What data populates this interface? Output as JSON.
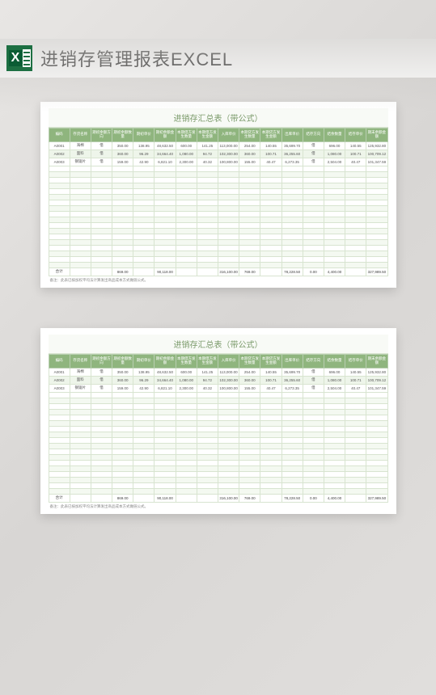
{
  "header": {
    "title": "进销存管理报表EXCEL",
    "icon_letter": "X"
  },
  "sheet": {
    "title": "进销存汇总表（带公式）",
    "columns": [
      "编码",
      "存货名称",
      "期初余额方向",
      "期初余额数量",
      "期初单价",
      "期初余额金额",
      "本期借方发生数量",
      "本期借方发生金额",
      "入库单价",
      "本期贷方发生数量",
      "本期贷方发生金额",
      "出库单价",
      "结存方向",
      "结余数量",
      "结存单价",
      "期末余额金额"
    ],
    "rows": [
      [
        "A0001",
        "海棉",
        "借",
        "350.00",
        "138.95",
        "48,632.50",
        "600.00",
        "141.25",
        "113,000.00",
        "254.00",
        "140.55",
        "35,699.70",
        "借",
        "696.00",
        "140.55",
        "125,932.80"
      ],
      [
        "A0002",
        "面料",
        "借",
        "360.00",
        "96.29",
        "34,664.40",
        "1,080.00",
        "94.72",
        "102,300.00",
        "360.00",
        "100.71",
        "36,255.60",
        "借",
        "1,080.00",
        "100.71",
        "100,709.12"
      ],
      [
        "A0003",
        "钢锯片",
        "借",
        "159.00",
        "42.90",
        "6,821.10",
        "2,300.00",
        "40.32",
        "100,800.00",
        "155.00",
        "40.47",
        "6,273.35",
        "借",
        "2,504.00",
        "40.47",
        "101,347.59"
      ]
    ],
    "total_label": "合计",
    "totals": [
      "",
      "869.00",
      "",
      "90,118.00",
      "",
      "",
      "316,100.00",
      "769.00",
      "",
      "78,228.50",
      "0.00",
      "4,400.00",
      "",
      "327,989.50"
    ],
    "footnote": "备注：此表已按加权平均法计算发出商品成本方式做链公式。"
  }
}
